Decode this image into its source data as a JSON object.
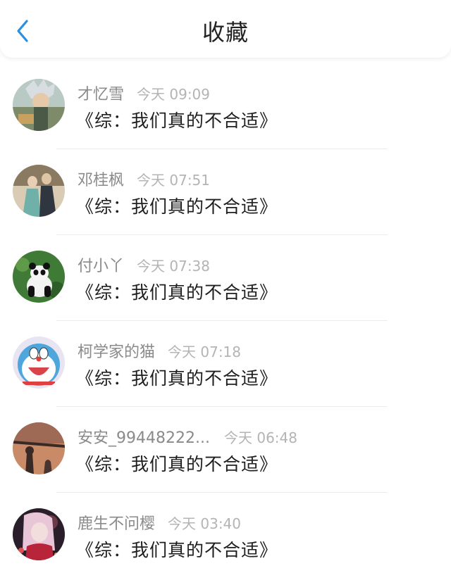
{
  "header": {
    "title": "收藏",
    "back_icon": "chevron-left-icon",
    "accent_color": "#2b8fe0"
  },
  "items": [
    {
      "name": "才忆雪",
      "time": "今天 09:09",
      "title": "《综：我们真的不合适》",
      "avatar": "anime-character-avatar"
    },
    {
      "name": "邓桂枫",
      "time": "今天 07:51",
      "title": "《综：我们真的不合适》",
      "avatar": "couple-photo-avatar"
    },
    {
      "name": "付小丫",
      "time": "今天 07:38",
      "title": "《综：我们真的不合适》",
      "avatar": "panda-avatar"
    },
    {
      "name": "柯学家的猫",
      "time": "今天 07:18",
      "title": "《综：我们真的不合适》",
      "avatar": "doraemon-avatar"
    },
    {
      "name": "安安_99448222...",
      "time": "今天 06:48",
      "title": "《综：我们真的不合适》",
      "avatar": "sunset-silhouette-avatar"
    },
    {
      "name": "鹿生不问樱",
      "time": "今天 03:40",
      "title": "《综：我们真的不合适》",
      "avatar": "anime-girl-avatar"
    }
  ]
}
